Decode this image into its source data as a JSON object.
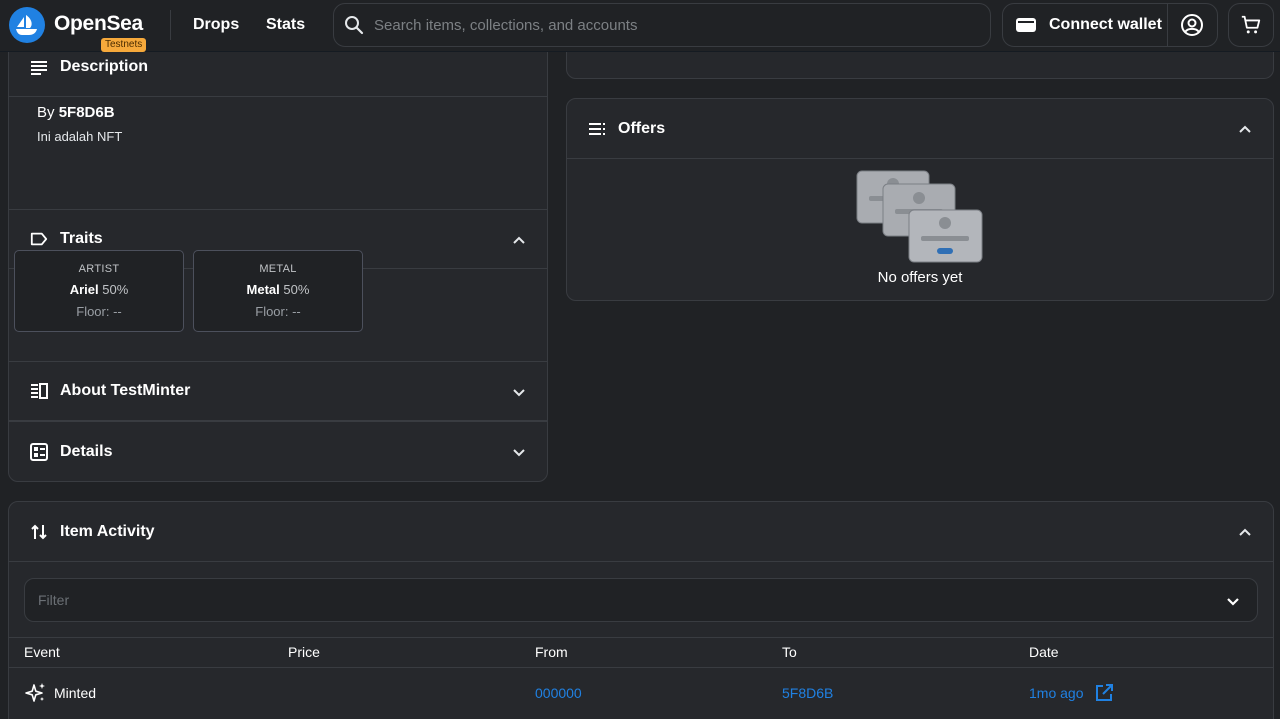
{
  "header": {
    "brand": "OpenSea",
    "badge": "Testnets",
    "nav": [
      "Drops",
      "Stats"
    ],
    "search_placeholder": "Search items, collections, and accounts",
    "connect_wallet": "Connect wallet"
  },
  "description": {
    "title": "Description",
    "by_prefix": "By",
    "creator": "5F8D6B",
    "text": "Ini adalah NFT"
  },
  "traits": {
    "title": "Traits",
    "items": [
      {
        "type": "ARTIST",
        "value": "Ariel",
        "percent": "50%",
        "floor": "Floor: --"
      },
      {
        "type": "METAL",
        "value": "Metal",
        "percent": "50%",
        "floor": "Floor: --"
      }
    ]
  },
  "about": {
    "title": "About TestMinter"
  },
  "details": {
    "title": "Details"
  },
  "offers": {
    "title": "Offers",
    "empty": "No offers yet"
  },
  "activity": {
    "title": "Item Activity",
    "filter_placeholder": "Filter",
    "columns": [
      "Event",
      "Price",
      "From",
      "To",
      "Date"
    ],
    "rows": [
      {
        "event": "Minted",
        "price": "",
        "from": "000000",
        "to": "5F8D6B",
        "date": "1mo ago"
      }
    ]
  }
}
